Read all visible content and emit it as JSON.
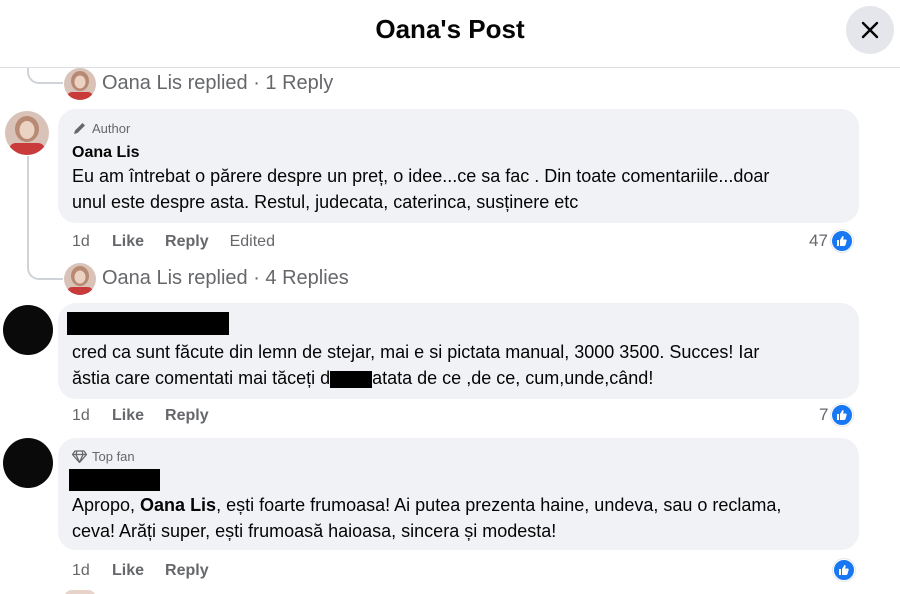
{
  "header": {
    "title": "Oana's Post"
  },
  "replies_top": {
    "text": "Oana Lis replied · 1 Reply"
  },
  "comment1": {
    "badge": "Author",
    "name": "Oana Lis",
    "lines": [
      "Eu am întrebat o părere despre un preț, o idee...ce sa fac . Din toate comentariile...doar",
      "unul este despre asta. Restul, judecata, caterinca, susținere etc"
    ],
    "time": "1d",
    "like": "Like",
    "reply": "Reply",
    "edited": "Edited",
    "reactions": "47"
  },
  "replies_mid": {
    "text": "Oana Lis replied · 4 Replies"
  },
  "comment2": {
    "line1": "cred ca sunt făcute din lemn de stejar, mai e si pictata manual, 3000 3500. Succes! Iar",
    "line2_a": "ăstia care comentati mai tăceți d",
    "line2_b": "atata de ce ,de ce, cum,unde,când!",
    "time": "1d",
    "like": "Like",
    "reply": "Reply",
    "reactions": "7"
  },
  "comment3": {
    "badge": "Top fan",
    "line1_a": "Apropo, ",
    "line1_name": "Oana Lis",
    "line1_b": ", ești foarte frumoasa! Ai putea prezenta haine, undeva, sau o reclama,",
    "line2": "ceva! Arăți super, ești frumoasă haioasa, sincera și modesta!",
    "time": "1d",
    "like": "Like",
    "reply": "Reply"
  },
  "colors": {
    "like_blue": "#1877f2",
    "bubble": "#f0f2f5",
    "muted": "#65676b"
  }
}
